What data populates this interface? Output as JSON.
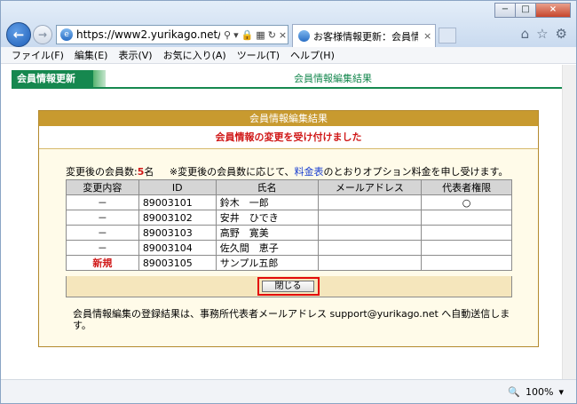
{
  "browser": {
    "address": "https://www2.yurikago.net/pl",
    "tab_title": "お客様情報更新：会員情...",
    "menu": [
      "ファイル(F)",
      "編集(E)",
      "表示(V)",
      "お気に入り(A)",
      "ツール(T)",
      "ヘルプ(H)"
    ],
    "zoom": "100%"
  },
  "page": {
    "section_label": "会員情報更新",
    "header_title": "会員情報編集結果",
    "panel_title": "会員情報編集結果",
    "success_message": "会員情報の変更を受け付けました",
    "count_prefix": "変更後の会員数:",
    "count_value": "5",
    "count_unit": "名",
    "note_prefix": "※変更後の会員数に応じて、",
    "note_link": "料金表",
    "note_suffix": "のとおりオプション料金を申し受けます。",
    "columns": [
      "変更内容",
      "ID",
      "氏名",
      "メールアドレス",
      "代表者権限"
    ],
    "rows": [
      {
        "change": "－",
        "id": "89003101",
        "name": "鈴木　一郎",
        "email": "",
        "rep": "○"
      },
      {
        "change": "－",
        "id": "89003102",
        "name": "安井　ひでき",
        "email": "",
        "rep": ""
      },
      {
        "change": "－",
        "id": "89003103",
        "name": "高野　寛美",
        "email": "",
        "rep": ""
      },
      {
        "change": "－",
        "id": "89003104",
        "name": "佐久間　恵子",
        "email": "",
        "rep": ""
      },
      {
        "change": "新規",
        "id": "89003105",
        "name": "サンプル五郎",
        "email": "",
        "rep": ""
      }
    ],
    "close_label": "閉じる",
    "footer_note": "会員情報編集の登録結果は、事務所代表者メールアドレス support@yurikago.net へ自動送信します。"
  },
  "colors": {
    "brand_green": "#16884f",
    "panel_gold": "#c89a2f",
    "alert_red": "#d01818"
  }
}
